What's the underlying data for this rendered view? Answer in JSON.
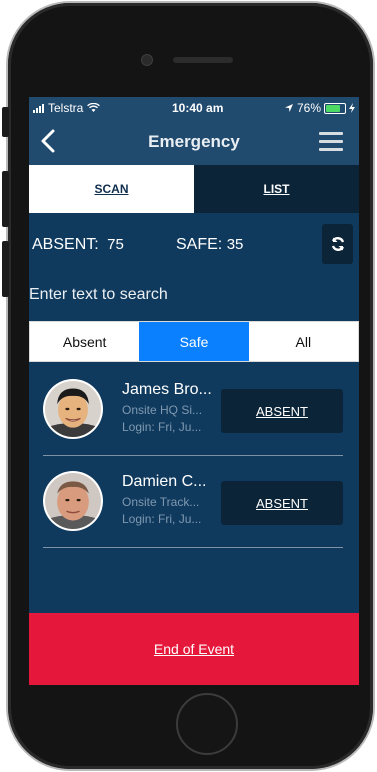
{
  "status_bar": {
    "carrier": "Telstra",
    "time": "10:40 am",
    "battery": "76%"
  },
  "header": {
    "title": "Emergency"
  },
  "tabs": [
    {
      "label": "SCAN"
    },
    {
      "label": "LIST"
    }
  ],
  "counts": {
    "absent": "ABSENT:",
    "absent_value": "75",
    "safe": "SAFE:",
    "safe_value": "35"
  },
  "search": {
    "placeholder": "Enter text to search"
  },
  "filter": {
    "options": [
      "Absent",
      "Safe",
      "All"
    ],
    "selected": "Safe"
  },
  "people": [
    {
      "name": "James Bro...",
      "location": "Onsite HQ Si...",
      "login": "Login: Fri, Ju...",
      "action": "ABSENT"
    },
    {
      "name": "Damien C...",
      "location": "Onsite Track...",
      "login": "Login: Fri, Ju...",
      "action": "ABSENT"
    }
  ],
  "footer": {
    "label": "End of Event"
  },
  "colors": {
    "navbar": "#204a6e",
    "background": "#0f3a5e",
    "dark_panel": "#0b2438",
    "accent": "#0a80ff",
    "danger": "#e5173a"
  }
}
